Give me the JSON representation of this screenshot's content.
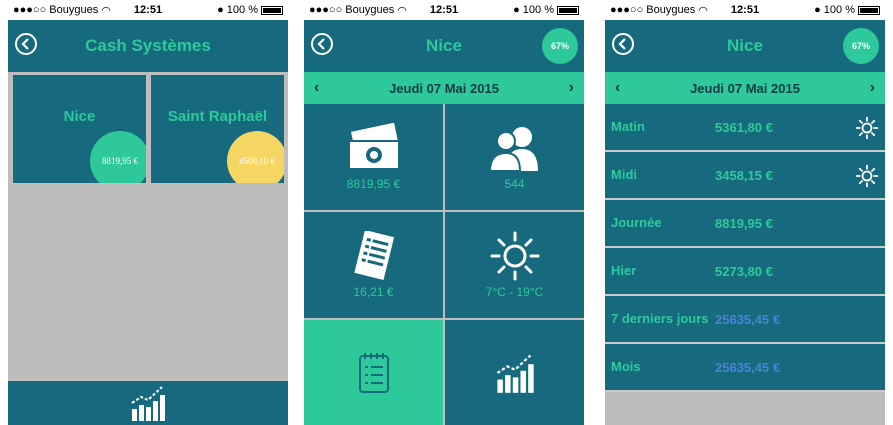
{
  "status": {
    "carrier": "●●●○○ Bouygues",
    "time": "12:51",
    "battery": "100 %"
  },
  "screen1": {
    "title": "Cash Systèmes",
    "cards": [
      {
        "name": "Nice",
        "amount": "8819,95 €",
        "color": "#2ec99a"
      },
      {
        "name": "Saint Raphaël",
        "amount": "4500,10 €",
        "color": "#f6d663"
      }
    ]
  },
  "screen2": {
    "title": "Nice",
    "percent": "67%",
    "date": "Jeudi 07 Mai 2015",
    "tiles": [
      {
        "icon": "cash-icon",
        "value": "8819,95 €"
      },
      {
        "icon": "people-icon",
        "value": "544"
      },
      {
        "icon": "receipt-icon",
        "value": "16,21 €"
      },
      {
        "icon": "sun-icon",
        "value": "7°C - 19°C"
      },
      {
        "icon": "list-icon",
        "value": ""
      },
      {
        "icon": "chart-icon",
        "value": ""
      }
    ]
  },
  "screen3": {
    "title": "Nice",
    "percent": "67%",
    "date": "Jeudi 07 Mai 2015",
    "rows": [
      {
        "label": "Matin",
        "amount": "5361,80 €",
        "sun": true
      },
      {
        "label": "Midi",
        "amount": "3458,15 €",
        "sun": true
      },
      {
        "label": "Journée",
        "amount": "8819,95 €"
      },
      {
        "label": "Hier",
        "amount": "5273,80 €"
      },
      {
        "label": "7 derniers jours",
        "amount": "25635,45 €",
        "accent": "blue"
      },
      {
        "label": "Mois",
        "amount": "25635,45 €",
        "accent": "blue"
      }
    ]
  },
  "colors": {
    "teal": "#176a7d",
    "green": "#2ec99a",
    "yellow": "#f6d663",
    "blue": "#4b83d8",
    "gray": "#bdbdbd"
  }
}
